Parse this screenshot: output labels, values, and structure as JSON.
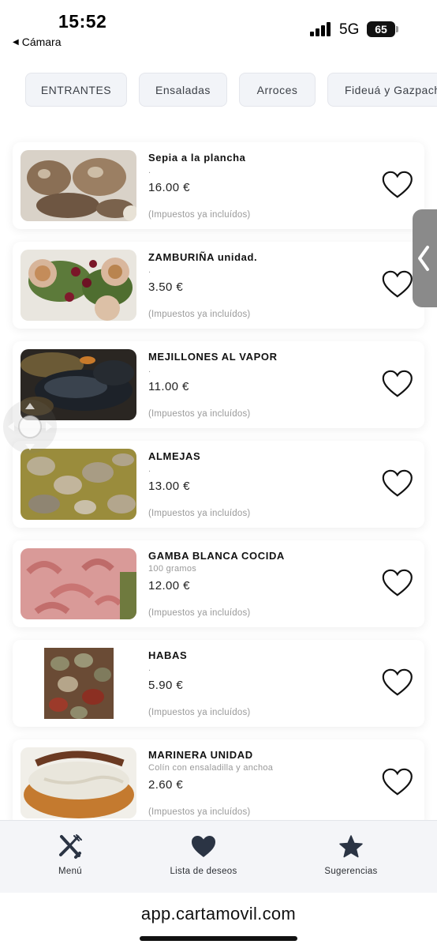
{
  "status_bar": {
    "time": "15:52",
    "back_label": "Cámara",
    "network": "5G",
    "battery": "65"
  },
  "categories": [
    {
      "label": "ENTRANTES"
    },
    {
      "label": "Ensaladas"
    },
    {
      "label": "Arroces"
    },
    {
      "label": "Fideuá y Gazpacho"
    }
  ],
  "products": [
    {
      "name": "Sepia a la plancha",
      "description": ".",
      "price": "16.00 €",
      "tax_note": "(Impuestos ya incluídos)",
      "favorite_icon": "heart-outline-icon"
    },
    {
      "name": "ZAMBURIÑA unidad.",
      "description": ".",
      "price": "3.50 €",
      "tax_note": "(Impuestos ya incluídos)",
      "favorite_icon": "heart-outline-icon"
    },
    {
      "name": "MEJILLONES AL VAPOR",
      "description": ".",
      "price": "11.00 €",
      "tax_note": "(Impuestos ya incluídos)",
      "favorite_icon": "heart-outline-icon"
    },
    {
      "name": "ALMEJAS",
      "description": ".",
      "price": "13.00 €",
      "tax_note": "(Impuestos ya incluídos)",
      "favorite_icon": "heart-outline-icon"
    },
    {
      "name": "GAMBA BLANCA COCIDA",
      "description": "100 gramos",
      "price": "12.00 €",
      "tax_note": "(Impuestos ya incluídos)",
      "favorite_icon": "heart-outline-icon"
    },
    {
      "name": "HABAS",
      "description": ".",
      "price": "5.90 €",
      "tax_note": "(Impuestos ya incluídos)",
      "favorite_icon": "heart-outline-icon"
    },
    {
      "name": "MARINERA UNIDAD",
      "description": "Colín con ensaladilla y anchoa",
      "price": "2.60 €",
      "tax_note": "(Impuestos ya incluídos)",
      "favorite_icon": "heart-outline-icon"
    }
  ],
  "bottom_nav": [
    {
      "label": "Menú",
      "icon": "fork-knife-icon"
    },
    {
      "label": "Lista de deseos",
      "icon": "heart-icon"
    },
    {
      "label": "Sugerencias",
      "icon": "star-icon"
    }
  ],
  "browser": {
    "url": "app.cartamovil.com"
  },
  "colors": {
    "tab_background": "#f2f4f8",
    "tab_border": "#e4e6ec",
    "nav_icon": "#2b3444",
    "side_handle": "#8a8a8a"
  }
}
